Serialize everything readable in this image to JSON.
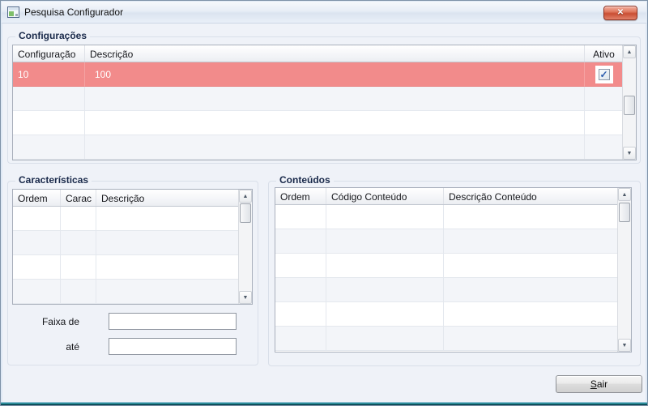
{
  "window": {
    "title": "Pesquisa Configurador"
  },
  "icons": {
    "close": "✕",
    "up": "▲",
    "down": "▼",
    "check": "✓"
  },
  "colors": {
    "selected_row": "#f28b8b",
    "selected_row_text": "#ffffff",
    "row_alt": "#f3f5f9",
    "group_label": "#19294a",
    "bottom_edge_teal": "#0b6470",
    "checkbox_check": "#2b5cad"
  },
  "configuracoes": {
    "label": "Configurações",
    "headers": [
      "Configuração",
      "Descrição",
      "Ativo"
    ],
    "rows": [
      {
        "configuracao": "10",
        "descricao": "100",
        "ativo_checked": true,
        "selected": true
      },
      {
        "configuracao": "",
        "descricao": "",
        "ativo_checked": null
      },
      {
        "configuracao": "",
        "descricao": "",
        "ativo_checked": null
      },
      {
        "configuracao": "",
        "descricao": "",
        "ativo_checked": null
      }
    ]
  },
  "caracteristicas": {
    "label": "Características",
    "headers": [
      "Ordem",
      "Carac",
      "Descrição"
    ],
    "empty_row_count": 4,
    "fields": {
      "faixa_de_label": "Faixa de",
      "faixa_de_value": "",
      "ate_label": "até",
      "ate_value": ""
    }
  },
  "conteudos": {
    "label": "Conteúdos",
    "headers": [
      "Ordem",
      "Código Conteúdo",
      "Descrição Conteúdo"
    ],
    "empty_row_count": 6
  },
  "footer": {
    "sair_accesskey": "S",
    "sair_rest": "air"
  }
}
